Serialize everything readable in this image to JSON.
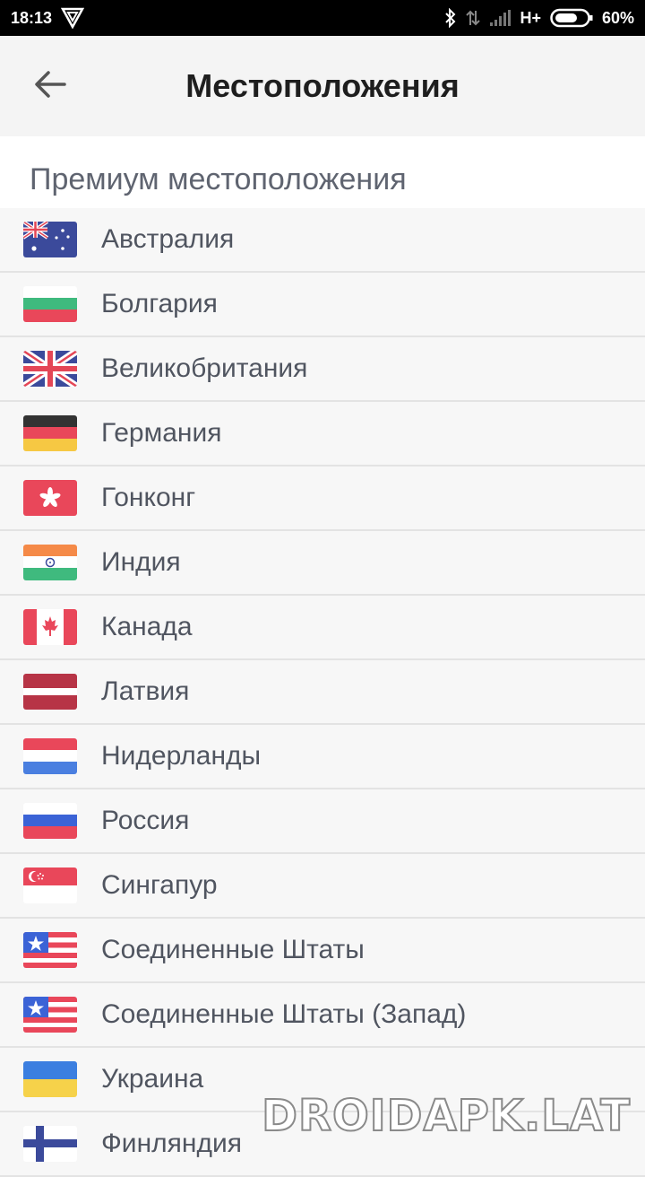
{
  "status_bar": {
    "time": "18:13",
    "network": "H+",
    "battery": "60%"
  },
  "header": {
    "title": "Местоположения",
    "back_icon": "arrow-back-icon"
  },
  "section": {
    "title": "Премиум местоположения"
  },
  "locations": [
    {
      "name": "Австралия",
      "flag": "au"
    },
    {
      "name": "Болгария",
      "flag": "bg"
    },
    {
      "name": "Великобритания",
      "flag": "gb"
    },
    {
      "name": "Германия",
      "flag": "de"
    },
    {
      "name": "Гонконг",
      "flag": "hk"
    },
    {
      "name": "Индия",
      "flag": "in"
    },
    {
      "name": "Канада",
      "flag": "ca"
    },
    {
      "name": "Латвия",
      "flag": "lv"
    },
    {
      "name": "Нидерланды",
      "flag": "nl"
    },
    {
      "name": "Россия",
      "flag": "ru"
    },
    {
      "name": "Сингапур",
      "flag": "sg"
    },
    {
      "name": "Соединенные Штаты",
      "flag": "us"
    },
    {
      "name": "Соединенные Штаты (Запад)",
      "flag": "us"
    },
    {
      "name": "Украина",
      "flag": "ua"
    },
    {
      "name": "Финляндия",
      "flag": "fi"
    }
  ],
  "watermark": "DROIDAPK.LAT"
}
